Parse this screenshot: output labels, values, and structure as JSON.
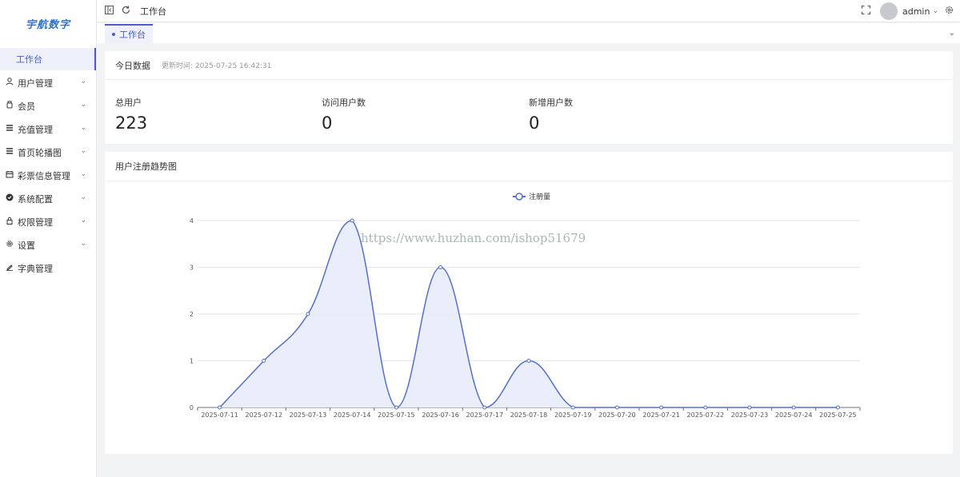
{
  "app": {
    "logo_text": "宇航数字"
  },
  "sidebar": {
    "items": [
      {
        "label": "工作台",
        "icon": "dashboard-icon"
      },
      {
        "label": "用户管理",
        "icon": "user-icon"
      },
      {
        "label": "会员",
        "icon": "member-icon"
      },
      {
        "label": "充值管理",
        "icon": "list-icon"
      },
      {
        "label": "首页轮播图",
        "icon": "carousel-icon"
      },
      {
        "label": "彩票信息管理",
        "icon": "calendar-icon"
      },
      {
        "label": "系统配置",
        "icon": "check-circle-icon"
      },
      {
        "label": "权限管理",
        "icon": "lock-icon"
      },
      {
        "label": "设置",
        "icon": "gear-icon"
      },
      {
        "label": "字典管理",
        "icon": "edit-icon"
      }
    ]
  },
  "header": {
    "breadcrumb": "工作台",
    "username": "admin"
  },
  "tabs": [
    {
      "label": "工作台"
    }
  ],
  "today": {
    "title": "今日数据",
    "updated": "更新时间: 2025-07-25 16:42:31",
    "stats": [
      {
        "label": "总用户",
        "value": "223"
      },
      {
        "label": "访问用户数",
        "value": "0"
      },
      {
        "label": "新增用户数",
        "value": "0"
      }
    ]
  },
  "chart_card": {
    "title": "用户注册趋势图"
  },
  "watermark": "https://www.huzhan.com/ishop51679",
  "colors": {
    "accent": "#4a5dc4",
    "series": "#5470c6",
    "fill": "#e8ebfa"
  },
  "chart_data": {
    "type": "line",
    "smooth": true,
    "area": true,
    "categories": [
      "2025-07-11",
      "2025-07-12",
      "2025-07-13",
      "2025-07-14",
      "2025-07-15",
      "2025-07-16",
      "2025-07-17",
      "2025-07-18",
      "2025-07-19",
      "2025-07-20",
      "2025-07-21",
      "2025-07-22",
      "2025-07-23",
      "2025-07-24",
      "2025-07-25"
    ],
    "series": [
      {
        "name": "注册量",
        "values": [
          0,
          1,
          2,
          4,
          0,
          3,
          0,
          1,
          0,
          0,
          0,
          0,
          0,
          0,
          0
        ]
      }
    ],
    "yticks": [
      0,
      1,
      2,
      3,
      4
    ],
    "ylim": [
      0,
      4
    ],
    "legend": "top-center",
    "grid": true
  }
}
